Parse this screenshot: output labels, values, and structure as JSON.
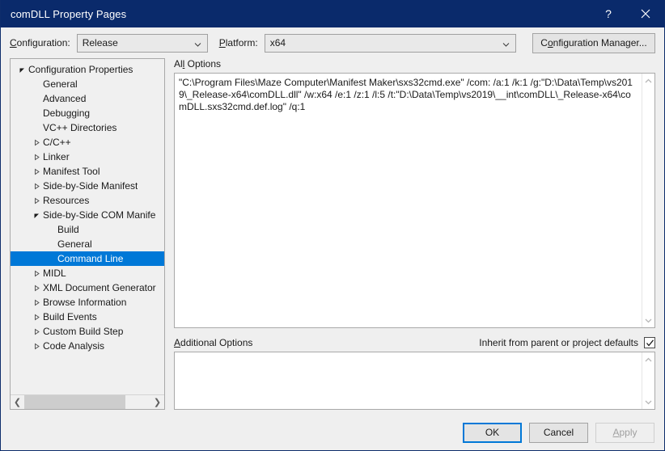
{
  "window": {
    "title": "comDLL Property Pages",
    "help_icon": "question-mark-icon",
    "close_icon": "close-icon",
    "titlebar_color": "#0a2a6b",
    "accent_color": "#0078d7"
  },
  "config_bar": {
    "configuration_label": "Configuration:",
    "configuration_value": "Release",
    "platform_label": "Platform:",
    "platform_value": "x64",
    "configuration_manager_button": "Configuration Manager..."
  },
  "tree": {
    "items": [
      {
        "label": "Configuration Properties",
        "indent": 0,
        "twisty": "expanded",
        "selected": false
      },
      {
        "label": "General",
        "indent": 1,
        "twisty": "none",
        "selected": false
      },
      {
        "label": "Advanced",
        "indent": 1,
        "twisty": "none",
        "selected": false
      },
      {
        "label": "Debugging",
        "indent": 1,
        "twisty": "none",
        "selected": false
      },
      {
        "label": "VC++ Directories",
        "indent": 1,
        "twisty": "none",
        "selected": false
      },
      {
        "label": "C/C++",
        "indent": 1,
        "twisty": "collapsed",
        "selected": false
      },
      {
        "label": "Linker",
        "indent": 1,
        "twisty": "collapsed",
        "selected": false
      },
      {
        "label": "Manifest Tool",
        "indent": 1,
        "twisty": "collapsed",
        "selected": false
      },
      {
        "label": "Side-by-Side Manifest",
        "indent": 1,
        "twisty": "collapsed",
        "selected": false
      },
      {
        "label": "Resources",
        "indent": 1,
        "twisty": "collapsed",
        "selected": false
      },
      {
        "label": "Side-by-Side COM Manife",
        "indent": 1,
        "twisty": "expanded",
        "selected": false
      },
      {
        "label": "Build",
        "indent": 2,
        "twisty": "none",
        "selected": false
      },
      {
        "label": "General",
        "indent": 2,
        "twisty": "none",
        "selected": false
      },
      {
        "label": "Command Line",
        "indent": 2,
        "twisty": "none",
        "selected": true
      },
      {
        "label": "MIDL",
        "indent": 1,
        "twisty": "collapsed",
        "selected": false
      },
      {
        "label": "XML Document Generator",
        "indent": 1,
        "twisty": "collapsed",
        "selected": false
      },
      {
        "label": "Browse Information",
        "indent": 1,
        "twisty": "collapsed",
        "selected": false
      },
      {
        "label": "Build Events",
        "indent": 1,
        "twisty": "collapsed",
        "selected": false
      },
      {
        "label": "Custom Build Step",
        "indent": 1,
        "twisty": "collapsed",
        "selected": false
      },
      {
        "label": "Code Analysis",
        "indent": 1,
        "twisty": "collapsed",
        "selected": false
      }
    ],
    "hscroll_left_icon": "chevron-left-icon",
    "hscroll_right_icon": "chevron-right-icon"
  },
  "all_options": {
    "label": "All Options",
    "value": "\"C:\\Program Files\\Maze Computer\\Manifest Maker\\sxs32cmd.exe\" /com: /a:1 /k:1 /g:\"D:\\Data\\Temp\\vs2019\\_Release-x64\\comDLL.dll\" /w:x64 /e:1 /z:1 /l:5 /t:\"D:\\Data\\Temp\\vs2019\\__int\\comDLL\\_Release-x64\\comDLL.sxs32cmd.def.log\" /q:1",
    "scroll_up_icon": "chevron-up-icon",
    "scroll_down_icon": "chevron-down-icon"
  },
  "additional_options": {
    "label": "Additional Options",
    "value": "",
    "placeholder": "",
    "inherit_label": "Inherit from parent or project defaults",
    "inherit_checked": true,
    "check_icon": "checkmark-icon",
    "scroll_up_icon": "chevron-up-icon",
    "scroll_down_icon": "chevron-down-icon"
  },
  "footer": {
    "ok_label": "OK",
    "cancel_label": "Cancel",
    "apply_label": "Apply",
    "apply_disabled": true
  }
}
